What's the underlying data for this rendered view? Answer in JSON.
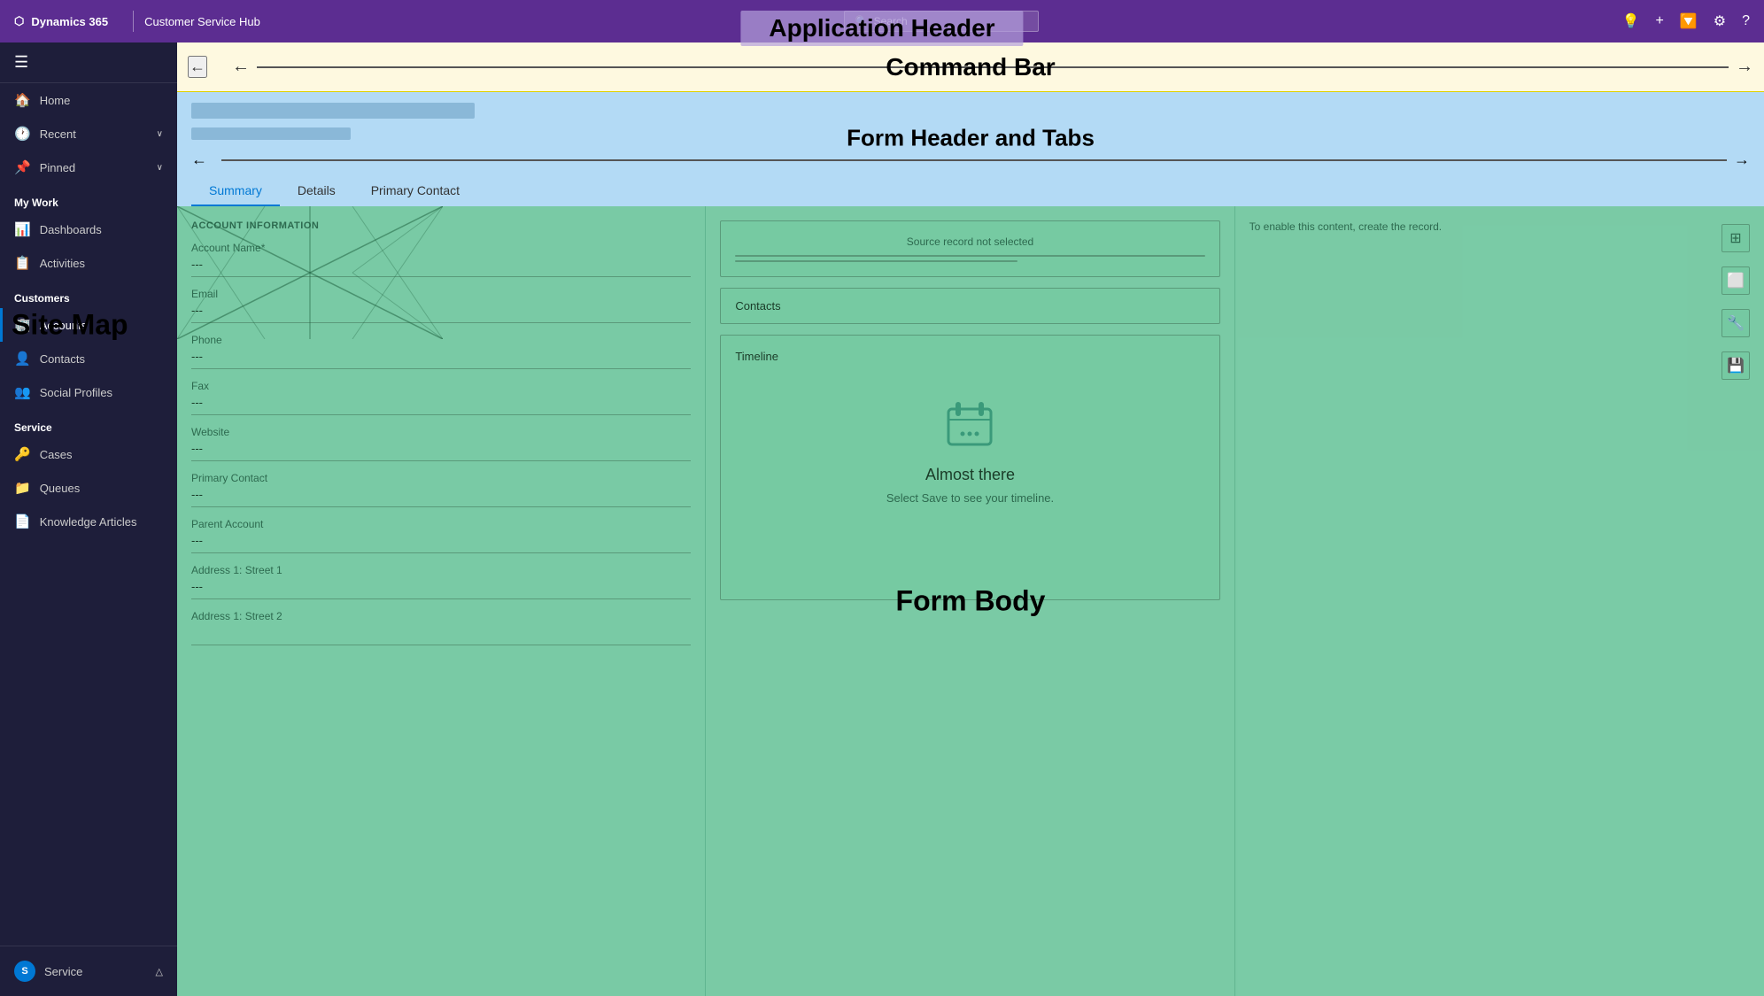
{
  "app": {
    "logo_icon": "apps-icon",
    "brand": "Dynamics 365",
    "separator": "|",
    "app_name": "Customer Service Hub",
    "search_placeholder": "Search",
    "header_title": "Application Header",
    "header_icon_bulb": "💡",
    "header_icon_add": "+",
    "header_icon_filter": "🔽",
    "header_icon_settings": "⚙",
    "header_icon_help": "?"
  },
  "sidebar": {
    "hamburger_icon": "☰",
    "nav_items": [
      {
        "id": "home",
        "label": "Home",
        "icon": "🏠"
      },
      {
        "id": "recent",
        "label": "Recent",
        "icon": "🕐",
        "chevron": "∨"
      },
      {
        "id": "pinned",
        "label": "Pinned",
        "icon": "📌",
        "chevron": "∨"
      }
    ],
    "my_work_label": "My Work",
    "my_work_items": [
      {
        "id": "dashboards",
        "label": "Dashboards",
        "icon": "📊"
      },
      {
        "id": "activities",
        "label": "Activities",
        "icon": "📋"
      }
    ],
    "customers_label": "Customers",
    "customers_items": [
      {
        "id": "accounts",
        "label": "Accounts",
        "icon": "🏢",
        "active": true
      },
      {
        "id": "contacts",
        "label": "Contacts",
        "icon": "👤"
      },
      {
        "id": "social-profiles",
        "label": "Social Profiles",
        "icon": "👥"
      }
    ],
    "service_label": "Service",
    "service_items": [
      {
        "id": "cases",
        "label": "Cases",
        "icon": "🔑"
      },
      {
        "id": "queues",
        "label": "Queues",
        "icon": "📁"
      },
      {
        "id": "knowledge-articles",
        "label": "Knowledge Articles",
        "icon": "📄"
      }
    ],
    "site_map_label": "Site Map",
    "bottom": {
      "avatar_letter": "S",
      "label": "Service"
    }
  },
  "command_bar": {
    "back_icon": "←",
    "title": "Command Bar",
    "arrow_left": "←",
    "arrow_right": "→"
  },
  "form_header": {
    "title": "Form Header and Tabs",
    "arrow_left": "←",
    "arrow_right": "→",
    "tabs": [
      {
        "id": "summary",
        "label": "Summary",
        "active": true
      },
      {
        "id": "details",
        "label": "Details",
        "active": false
      },
      {
        "id": "primary-contact",
        "label": "Primary Contact",
        "active": false
      }
    ]
  },
  "form_body": {
    "title": "Form Body",
    "left_col": {
      "section_title": "ACCOUNT INFORMATION",
      "fields": [
        {
          "label": "Account Name*",
          "value": "---"
        },
        {
          "label": "Email",
          "value": "---"
        },
        {
          "label": "Phone",
          "value": "---"
        },
        {
          "label": "Fax",
          "value": "---"
        },
        {
          "label": "Website",
          "value": "---"
        },
        {
          "label": "Primary Contact",
          "value": "---"
        },
        {
          "label": "Parent Account",
          "value": "---"
        },
        {
          "label": "Address 1: Street 1",
          "value": "---"
        },
        {
          "label": "Address 1: Street 2",
          "value": ""
        }
      ]
    },
    "mid_col": {
      "source_record_text": "Source record not selected",
      "contacts_title": "Contacts",
      "timeline_title": "Timeline",
      "almost_there": "Almost there",
      "save_prompt": "Select Save to see your timeline."
    },
    "right_col": {
      "enable_text": "To enable this content, create the record.",
      "icons": [
        {
          "id": "grid-icon",
          "symbol": "⊞"
        },
        {
          "id": "window-icon",
          "symbol": "⬜"
        },
        {
          "id": "wrench-icon",
          "symbol": "🔧"
        },
        {
          "id": "save-icon",
          "symbol": "💾"
        }
      ]
    }
  }
}
